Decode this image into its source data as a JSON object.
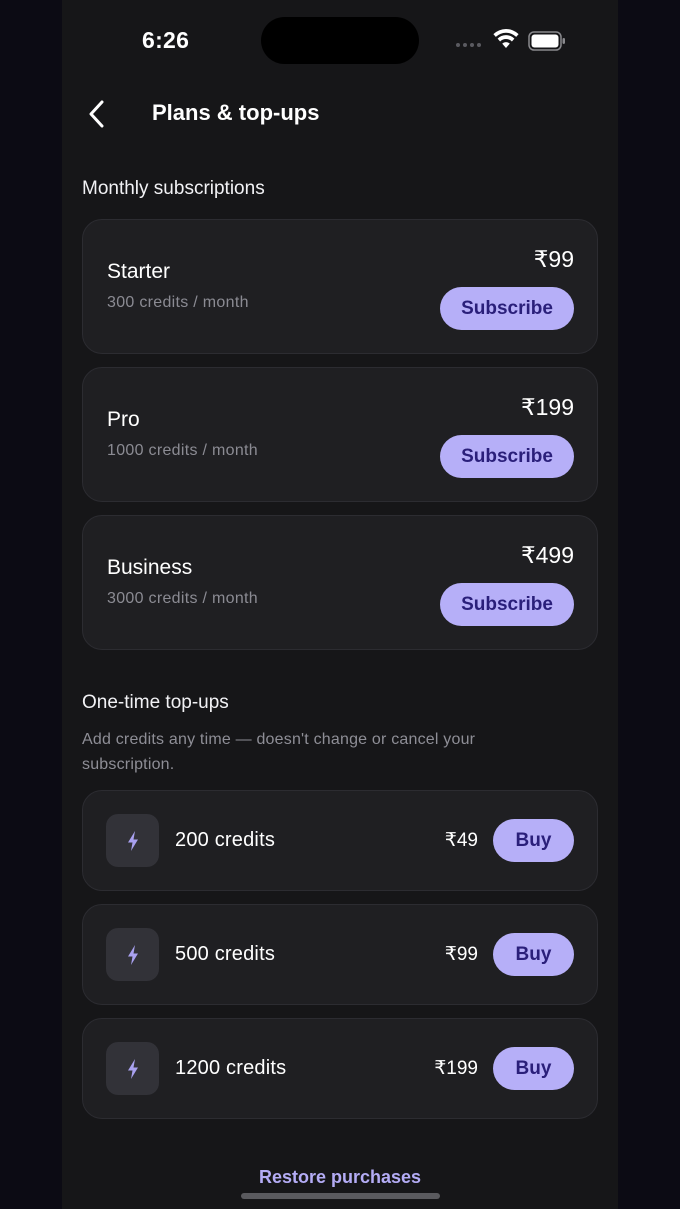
{
  "status_bar": {
    "time": "6:26"
  },
  "header": {
    "title": "Plans & top-ups"
  },
  "subscriptions": {
    "title": "Monthly subscriptions",
    "plans": [
      {
        "name": "Starter",
        "credits": "300 credits / month",
        "price": "₹99",
        "button": "Subscribe"
      },
      {
        "name": "Pro",
        "credits": "1000 credits / month",
        "price": "₹199",
        "button": "Subscribe"
      },
      {
        "name": "Business",
        "credits": "3000 credits / month",
        "price": "₹499",
        "button": "Subscribe"
      }
    ]
  },
  "topups": {
    "title": "One-time top-ups",
    "description": "Add credits any time — doesn't change or cancel your subscription.",
    "items": [
      {
        "credits": "200 credits",
        "price": "₹49",
        "button": "Buy",
        "icon": "bolt-icon"
      },
      {
        "credits": "500 credits",
        "price": "₹99",
        "button": "Buy",
        "icon": "bolt-icon"
      },
      {
        "credits": "1200 credits",
        "price": "₹199",
        "button": "Buy",
        "icon": "bolt-icon"
      }
    ]
  },
  "footer": {
    "restore_label": "Restore purchases"
  },
  "colors": {
    "background": "#161618",
    "card": "#1f1f22",
    "accent": "#b6aff8",
    "accent_text": "#2a1f7a",
    "muted_text": "#8b8b93"
  }
}
